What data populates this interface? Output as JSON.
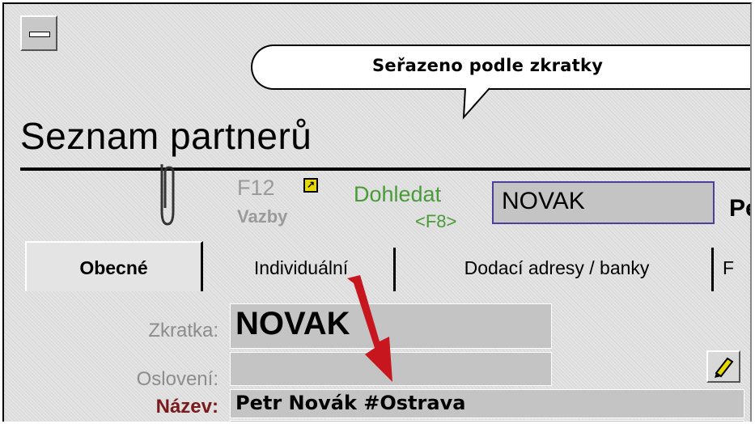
{
  "callout": {
    "text": "Seřazeno podle zkratky"
  },
  "window": {
    "title": "Seznam partnerů"
  },
  "toolbar": {
    "f12_label": "F12",
    "vazby_label": "Vazby",
    "dohledat_label": "Dohledat",
    "f8_label": "<F8>",
    "search_value": "NOVAK",
    "truncated_label": "Pe"
  },
  "tabs": [
    {
      "label": "Obecné",
      "active": true
    },
    {
      "label": "Individuální",
      "active": false
    },
    {
      "label": "Dodací adresy / banky",
      "active": false
    },
    {
      "label": "F",
      "active": false
    }
  ],
  "form": {
    "zkratka_label": "Zkratka:",
    "zkratka_value": "NOVAK",
    "osloveni_label": "Oslovení:",
    "osloveni_value": "",
    "nazev_label": "Název:",
    "nazev_value": "Petr Novák #Ostrava"
  },
  "colors": {
    "accent_green": "#4a9a3a",
    "required_label": "#7a1a1a",
    "arrow_red": "#c8161e",
    "search_border": "#4b3f99"
  },
  "icons": {
    "system_menu": "system-menu-icon",
    "paperclip": "paperclip-icon",
    "f12_link": "link-arrow-icon",
    "edit": "pencil-icon",
    "annotation_arrow": "red-arrow-icon"
  }
}
